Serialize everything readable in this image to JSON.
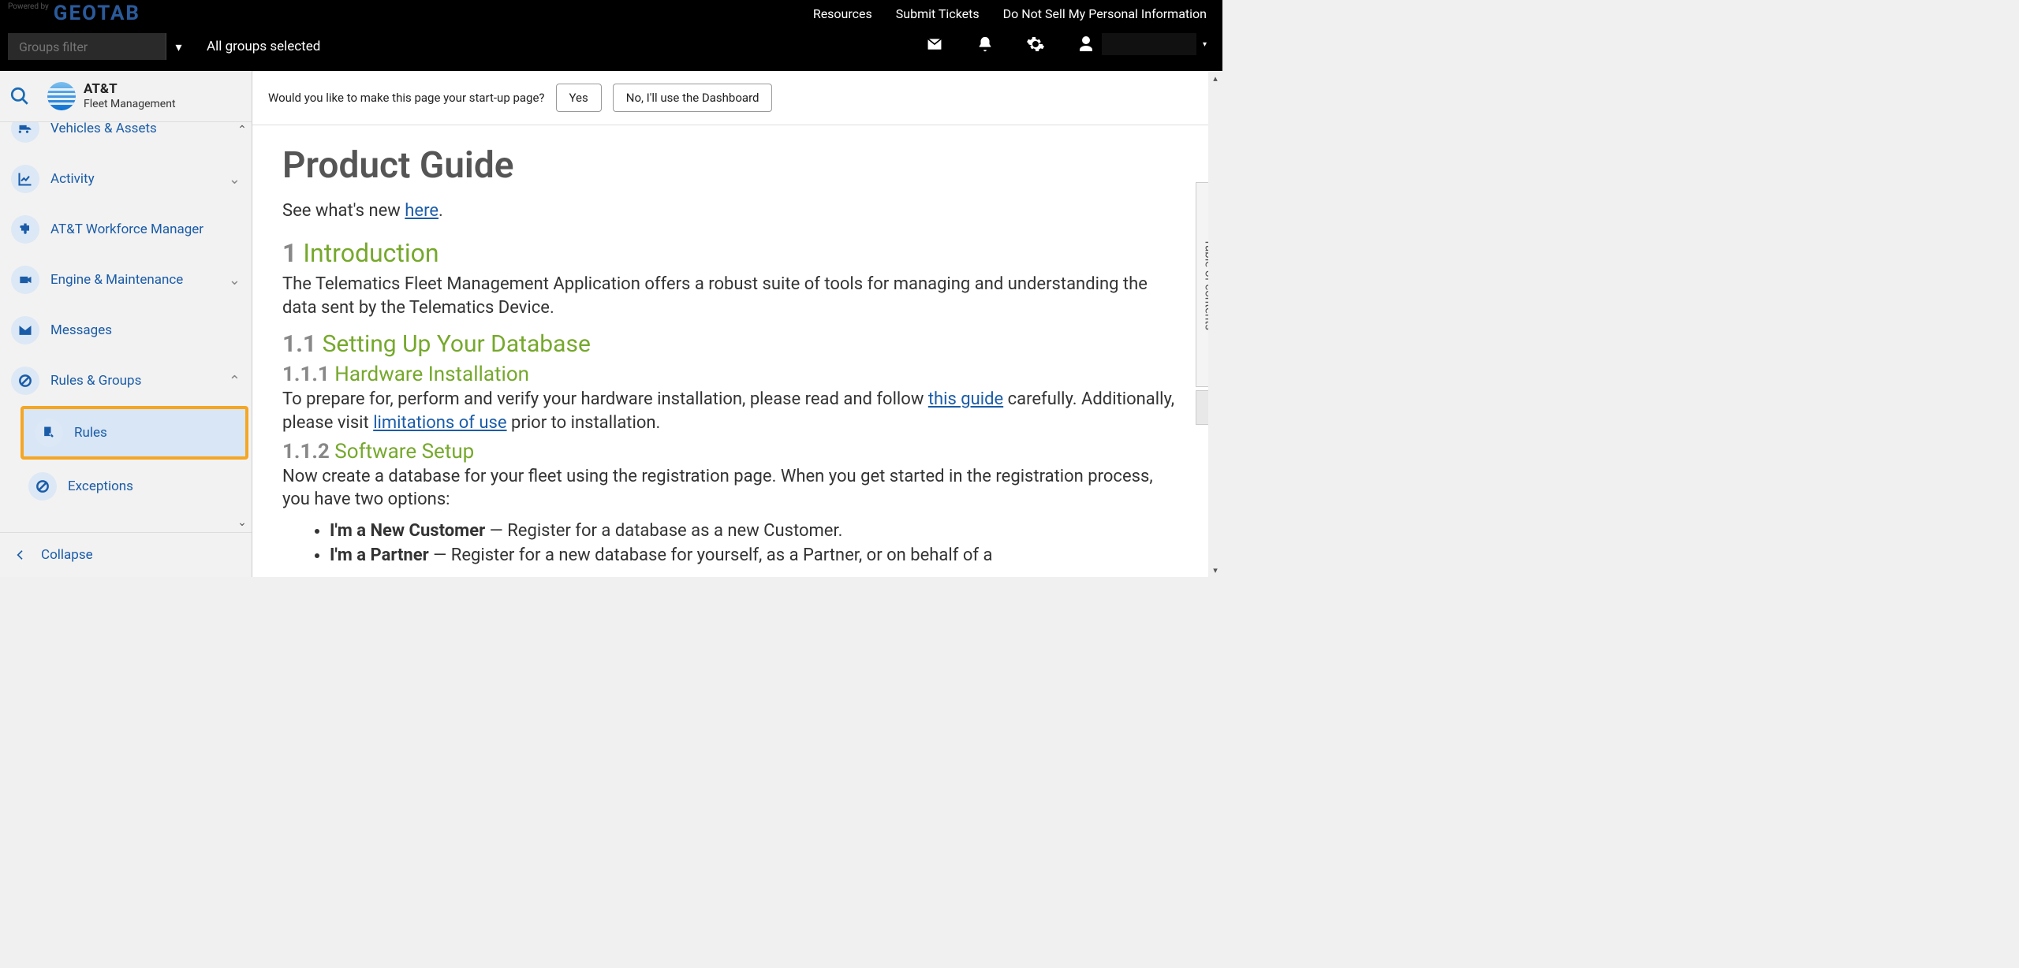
{
  "topbar": {
    "powered_by": "Powered by",
    "logo_text": "GEOTAB",
    "links": [
      "Resources",
      "Submit Tickets",
      "Do Not Sell My Personal Information"
    ],
    "groups_filter_placeholder": "Groups filter",
    "groups_selected_text": "All groups selected"
  },
  "brand": {
    "line1": "AT&T",
    "line2": "Fleet Management"
  },
  "sidebar": {
    "items": [
      {
        "label": "Vehicles & Assets",
        "icon": "truck-icon",
        "expand": false
      },
      {
        "label": "Activity",
        "icon": "chart-icon",
        "expand": true,
        "chev": "down"
      },
      {
        "label": "AT&T Workforce Manager",
        "icon": "puzzle-icon",
        "expand": false
      },
      {
        "label": "Engine & Maintenance",
        "icon": "camera-icon",
        "expand": true,
        "chev": "down"
      },
      {
        "label": "Messages",
        "icon": "envelope-icon",
        "expand": false
      },
      {
        "label": "Rules & Groups",
        "icon": "nosign-icon",
        "expand": true,
        "chev": "up"
      }
    ],
    "sub_rules": "Rules",
    "sub_exceptions": "Exceptions",
    "collapse": "Collapse"
  },
  "startup": {
    "prompt": "Would you like to make this page your start-up page?",
    "yes": "Yes",
    "no": "No, I'll use the Dashboard"
  },
  "doc": {
    "title": "Product Guide",
    "whatsnew_prefix": "See what's new ",
    "whatsnew_link": "here",
    "whatsnew_suffix": ".",
    "s1_num": "1 ",
    "s1_title": "Introduction",
    "s1_body": "The Telematics Fleet Management Application offers a robust suite of tools for managing and understanding the data sent by the Telematics Device.",
    "s11_num": "1.1 ",
    "s11_title": "Setting Up Your Database",
    "s111_num": "1.1.1 ",
    "s111_title": "Hardware Installation",
    "s111_body_a": "To prepare for, perform and verify your hardware installation, please read and follow ",
    "s111_link1": "this guide",
    "s111_body_b": " carefully. Additionally, please visit ",
    "s111_link2": "limitations of use",
    "s111_body_c": " prior to installation.",
    "s112_num": "1.1.2 ",
    "s112_title": "Software Setup",
    "s112_body": "Now create a database for your fleet using the registration page. When you get started in the registration process, you have two options:",
    "li1_b": "I'm a New Customer",
    "li1_r": " — Register for a database as a new Customer.",
    "li2_b": "I'm a Partner",
    "li2_r": " — Register for a new database for yourself, as a Partner, or on behalf of a",
    "toc_label": "Table of contents"
  }
}
